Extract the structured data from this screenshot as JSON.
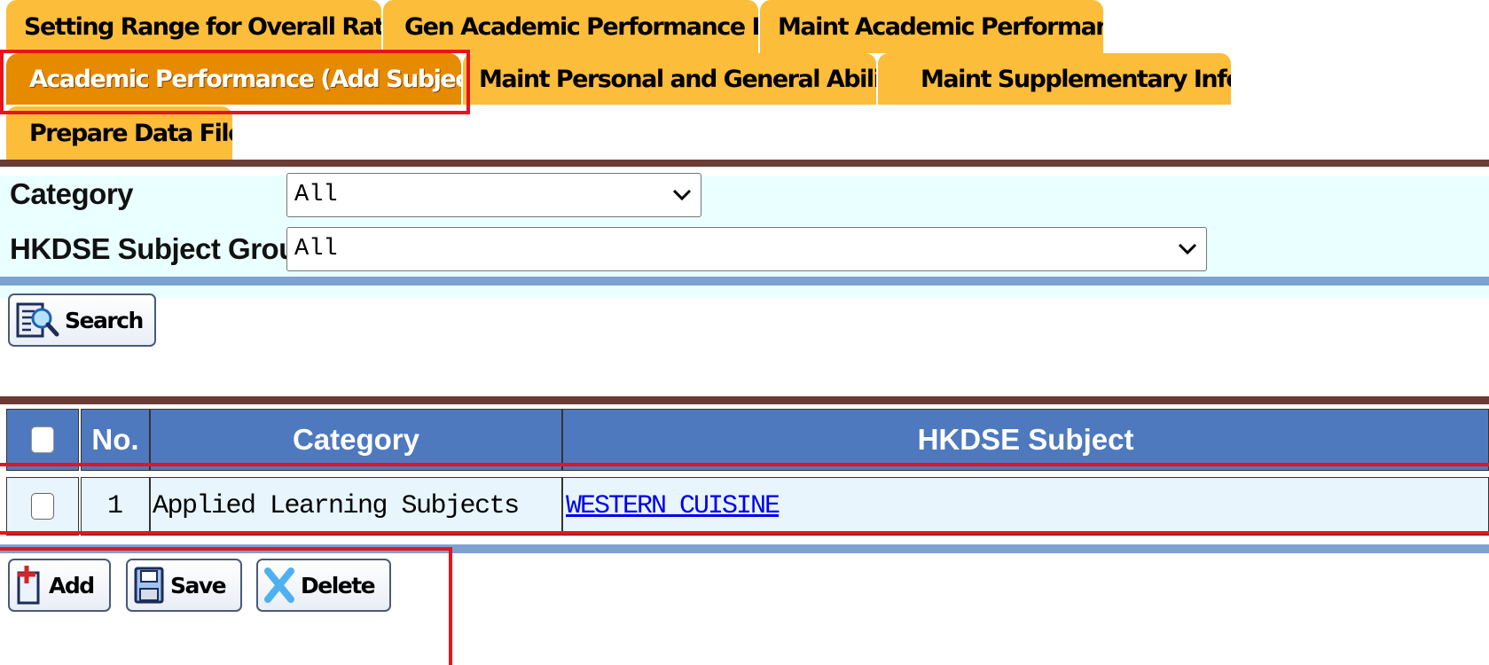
{
  "tabs": {
    "setting_range": "Setting Range for Overall Rating",
    "gen_academic": "Gen Academic Performance Info",
    "maint_academic": "Maint Academic Performance",
    "add_subjects": "Academic Performance (Add Subjects)",
    "maint_personal": "Maint Personal and General Abilities",
    "maint_supplementary": "Maint Supplementary Info",
    "prepare_data": "Prepare Data File"
  },
  "filters": {
    "category_label": "Category",
    "category_value": "All",
    "subject_group_label": "HKDSE Subject Group",
    "subject_group_value": "All"
  },
  "buttons": {
    "search": "Search",
    "add": "Add",
    "save": "Save",
    "delete": "Delete"
  },
  "table": {
    "headers": {
      "no": "No.",
      "category": "Category",
      "subject": "HKDSE Subject"
    },
    "rows": [
      {
        "no": "1",
        "category": "Applied Learning Subjects",
        "subject": "WESTERN CUISINE"
      }
    ]
  },
  "colors": {
    "tab": "#fbbd3a",
    "tab_active": "#e68a00",
    "header": "#4e79bf",
    "highlight": "#e8141b",
    "link": "#0000ee"
  }
}
